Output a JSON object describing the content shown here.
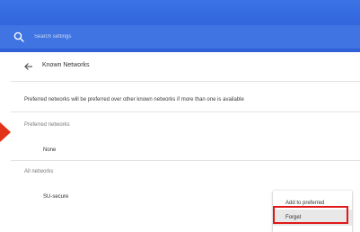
{
  "search": {
    "placeholder": "Search settings",
    "icon": "search-icon"
  },
  "page": {
    "title": "Known Networks",
    "back_icon": "arrow-left-icon",
    "description": "Preferred networks will be preferred over other known networks if more than one is available"
  },
  "preferred": {
    "header": "Preferred networks",
    "items": [
      "None"
    ]
  },
  "all": {
    "header": "All networks",
    "items": [
      "SU-secure"
    ]
  },
  "menu": {
    "items": [
      "Add to preferred",
      "Forget"
    ]
  },
  "colors": {
    "header_blue": "#3368de",
    "highlight_red": "#e01818",
    "annotation_arrow": "#e23419"
  }
}
